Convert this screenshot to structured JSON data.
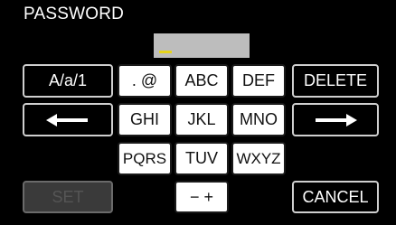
{
  "header": {
    "title": "PASSWORD"
  },
  "password_field": {
    "value": ""
  },
  "keys": {
    "mode": "A/a/1",
    "dot_at": ". @",
    "abc": "ABC",
    "def": "DEF",
    "delete": "DELETE",
    "ghi": "GHI",
    "jkl": "JKL",
    "mno": "MNO",
    "pqrs": "PQRS",
    "tuv": "TUV",
    "wxyz": "WXYZ",
    "set": "SET",
    "minus_plus": "− +",
    "cancel": "CANCEL"
  },
  "icons": {
    "left": "arrow-left-icon",
    "right": "arrow-right-icon"
  },
  "colors": {
    "background": "#000000",
    "field": "#bdbdbd",
    "cursor": "#e6d41a"
  }
}
